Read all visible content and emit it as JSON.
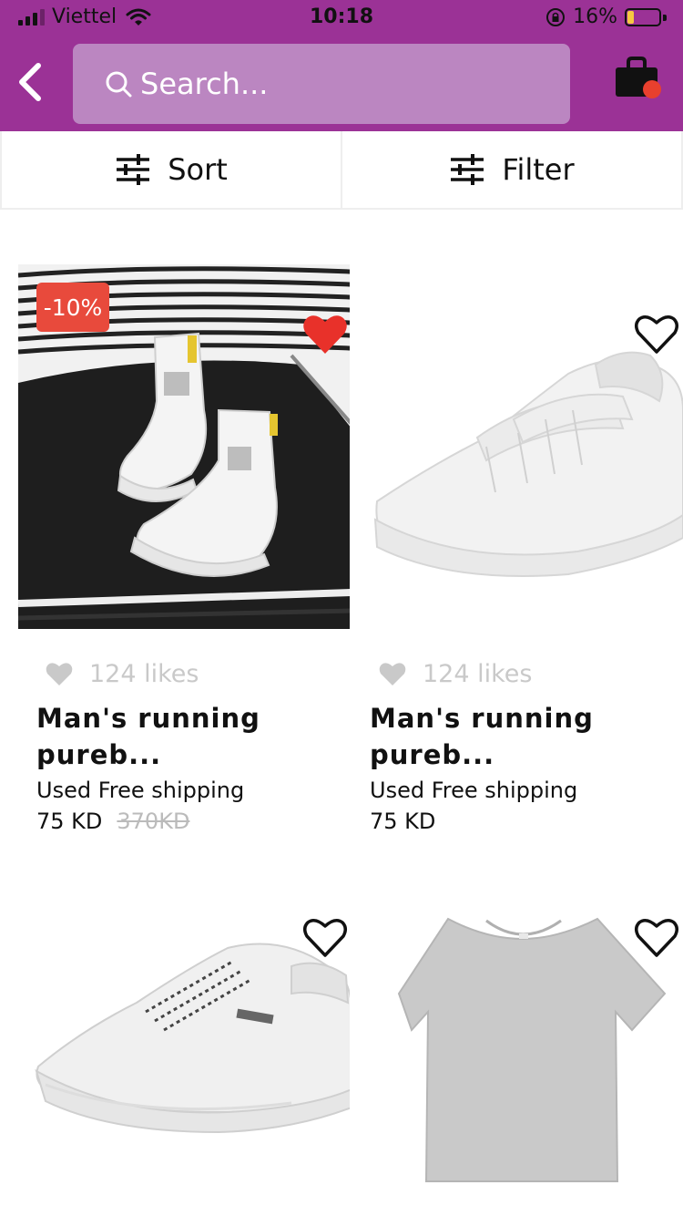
{
  "status_bar": {
    "carrier": "Viettel",
    "time": "10:18",
    "battery": "16%"
  },
  "header": {
    "search_placeholder": "Search...",
    "cart_badge_color": "#e8402e"
  },
  "sort_bar": {
    "sort_label": "Sort",
    "filter_label": "Filter"
  },
  "products": [
    {
      "discount": "-10%",
      "favorited": true,
      "likes": "124 likes",
      "title": "Man's running pureb...",
      "shipping": "Used Free shipping",
      "price": "75 KD",
      "old_price": "370KD"
    },
    {
      "favorited": false,
      "likes": "124 likes",
      "title": "Man's running pureb...",
      "shipping": "Used Free shipping",
      "price": "75 KD"
    },
    {
      "favorited": false
    },
    {
      "favorited": false
    }
  ],
  "colors": {
    "header_bg": "#9b3296",
    "search_bg": "#bb86c1",
    "badge": "#e84a3c",
    "heart_active": "#e8312a"
  }
}
